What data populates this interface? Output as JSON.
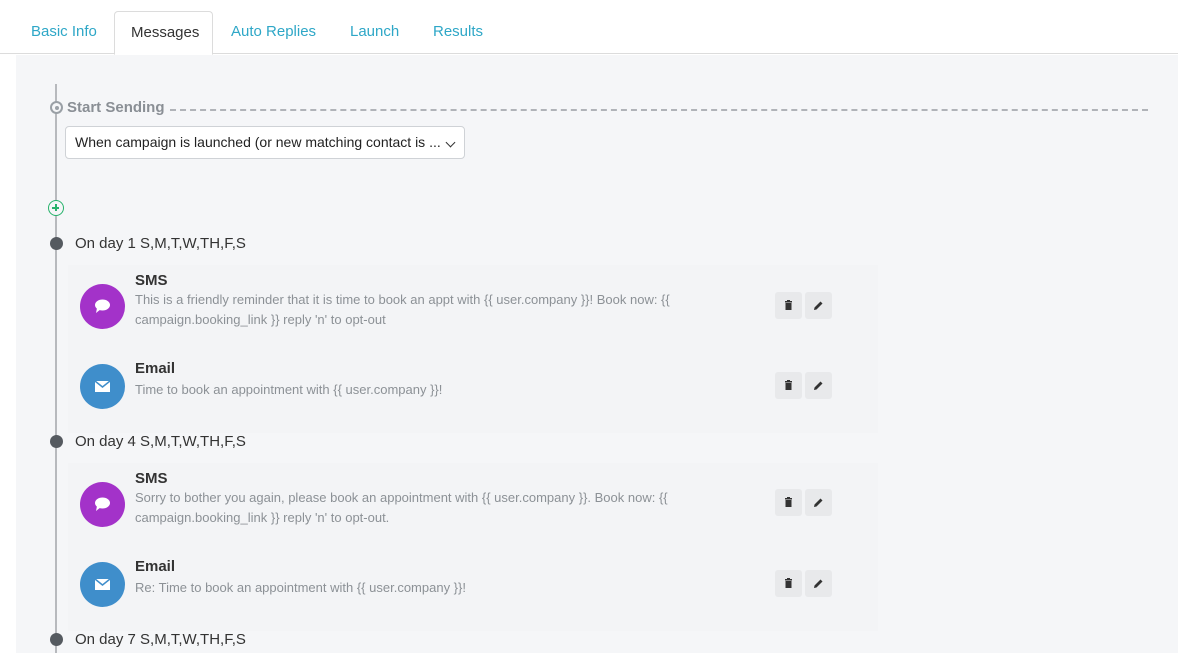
{
  "tabs": [
    {
      "label": "Basic Info",
      "active": false
    },
    {
      "label": "Messages",
      "active": true
    },
    {
      "label": "Auto Replies",
      "active": false
    },
    {
      "label": "Launch",
      "active": false
    },
    {
      "label": "Results",
      "active": false
    }
  ],
  "start": {
    "label": "Start Sending",
    "trigger": "When campaign is launched (or new matching contact is ..."
  },
  "days": [
    {
      "label": "On day 1 S,M,T,W,TH,F,S",
      "messages": [
        {
          "type": "SMS",
          "icon": "chat-bubble-icon",
          "body": "This is a friendly reminder that it is time to book an appt with {{ user.company }}! Book now: {{ campaign.booking_link }} reply 'n' to opt-out"
        },
        {
          "type": "Email",
          "icon": "envelope-icon",
          "body": "Time to book an appointment with {{ user.company }}!"
        }
      ]
    },
    {
      "label": "On day 4 S,M,T,W,TH,F,S",
      "messages": [
        {
          "type": "SMS",
          "icon": "chat-bubble-icon",
          "body": "Sorry to bother you again, please book an appointment with {{ user.company }}. Book now: {{ campaign.booking_link }} reply 'n' to opt-out."
        },
        {
          "type": "Email",
          "icon": "envelope-icon",
          "body": "Re: Time to book an appointment with {{ user.company }}!"
        }
      ]
    },
    {
      "label": "On day 7 S,M,T,W,TH,F,S",
      "messages": []
    }
  ],
  "colors": {
    "tab_link": "#2ea7c7",
    "sms": "#a332c9",
    "email": "#3f8ecb",
    "add": "#27b26b"
  }
}
